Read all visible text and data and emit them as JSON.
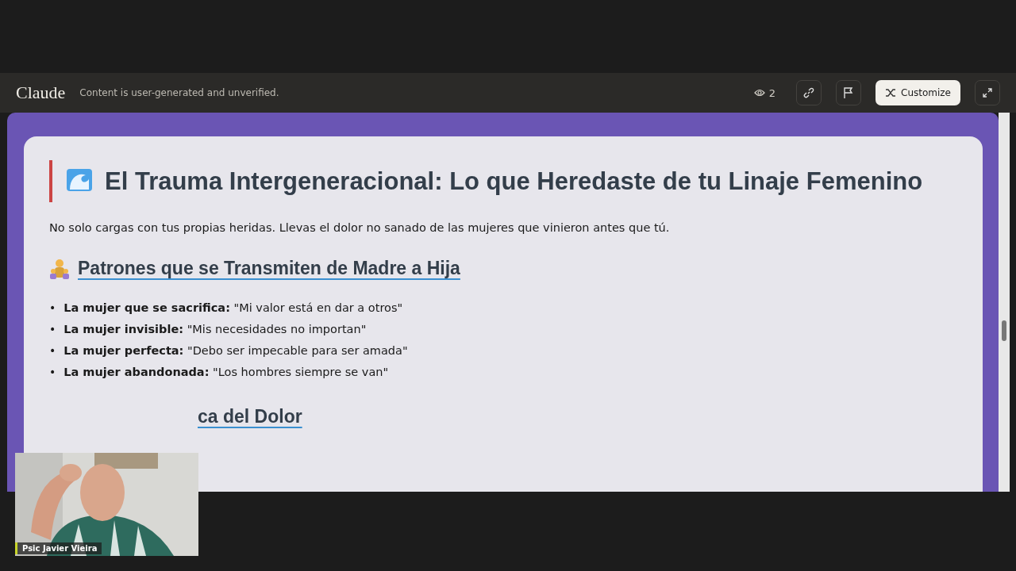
{
  "header": {
    "brand": "Claude",
    "notice": "Content is user-generated and unverified.",
    "viewers": "2",
    "customize": "Customize"
  },
  "article": {
    "title": "El Trauma Intergeneracional: Lo que Heredaste de tu Linaje Femenino",
    "intro": "No solo cargas con tus propias heridas. Llevas el dolor no sanado de las mujeres que vinieron antes que tú.",
    "sections": [
      {
        "heading": "Patrones que se Transmiten de Madre a Hija",
        "items": [
          {
            "bullet": "•",
            "label": "La mujer que se sacrifica:",
            "quote": "\"Mi valor está en dar a otros\""
          },
          {
            "bullet": "•",
            "label": "La mujer invisible:",
            "quote": "\"Mis necesidades no importan\""
          },
          {
            "bullet": "•",
            "label": "La mujer perfecta:",
            "quote": "\"Debo ser impecable para ser amada\""
          },
          {
            "bullet": "•",
            "label": "La mujer abandonada:",
            "quote": "\"Los hombres siempre se van\""
          }
        ]
      },
      {
        "heading": "ca del Dolor"
      }
    ]
  },
  "video": {
    "name": "Psic Javier Vieira"
  }
}
